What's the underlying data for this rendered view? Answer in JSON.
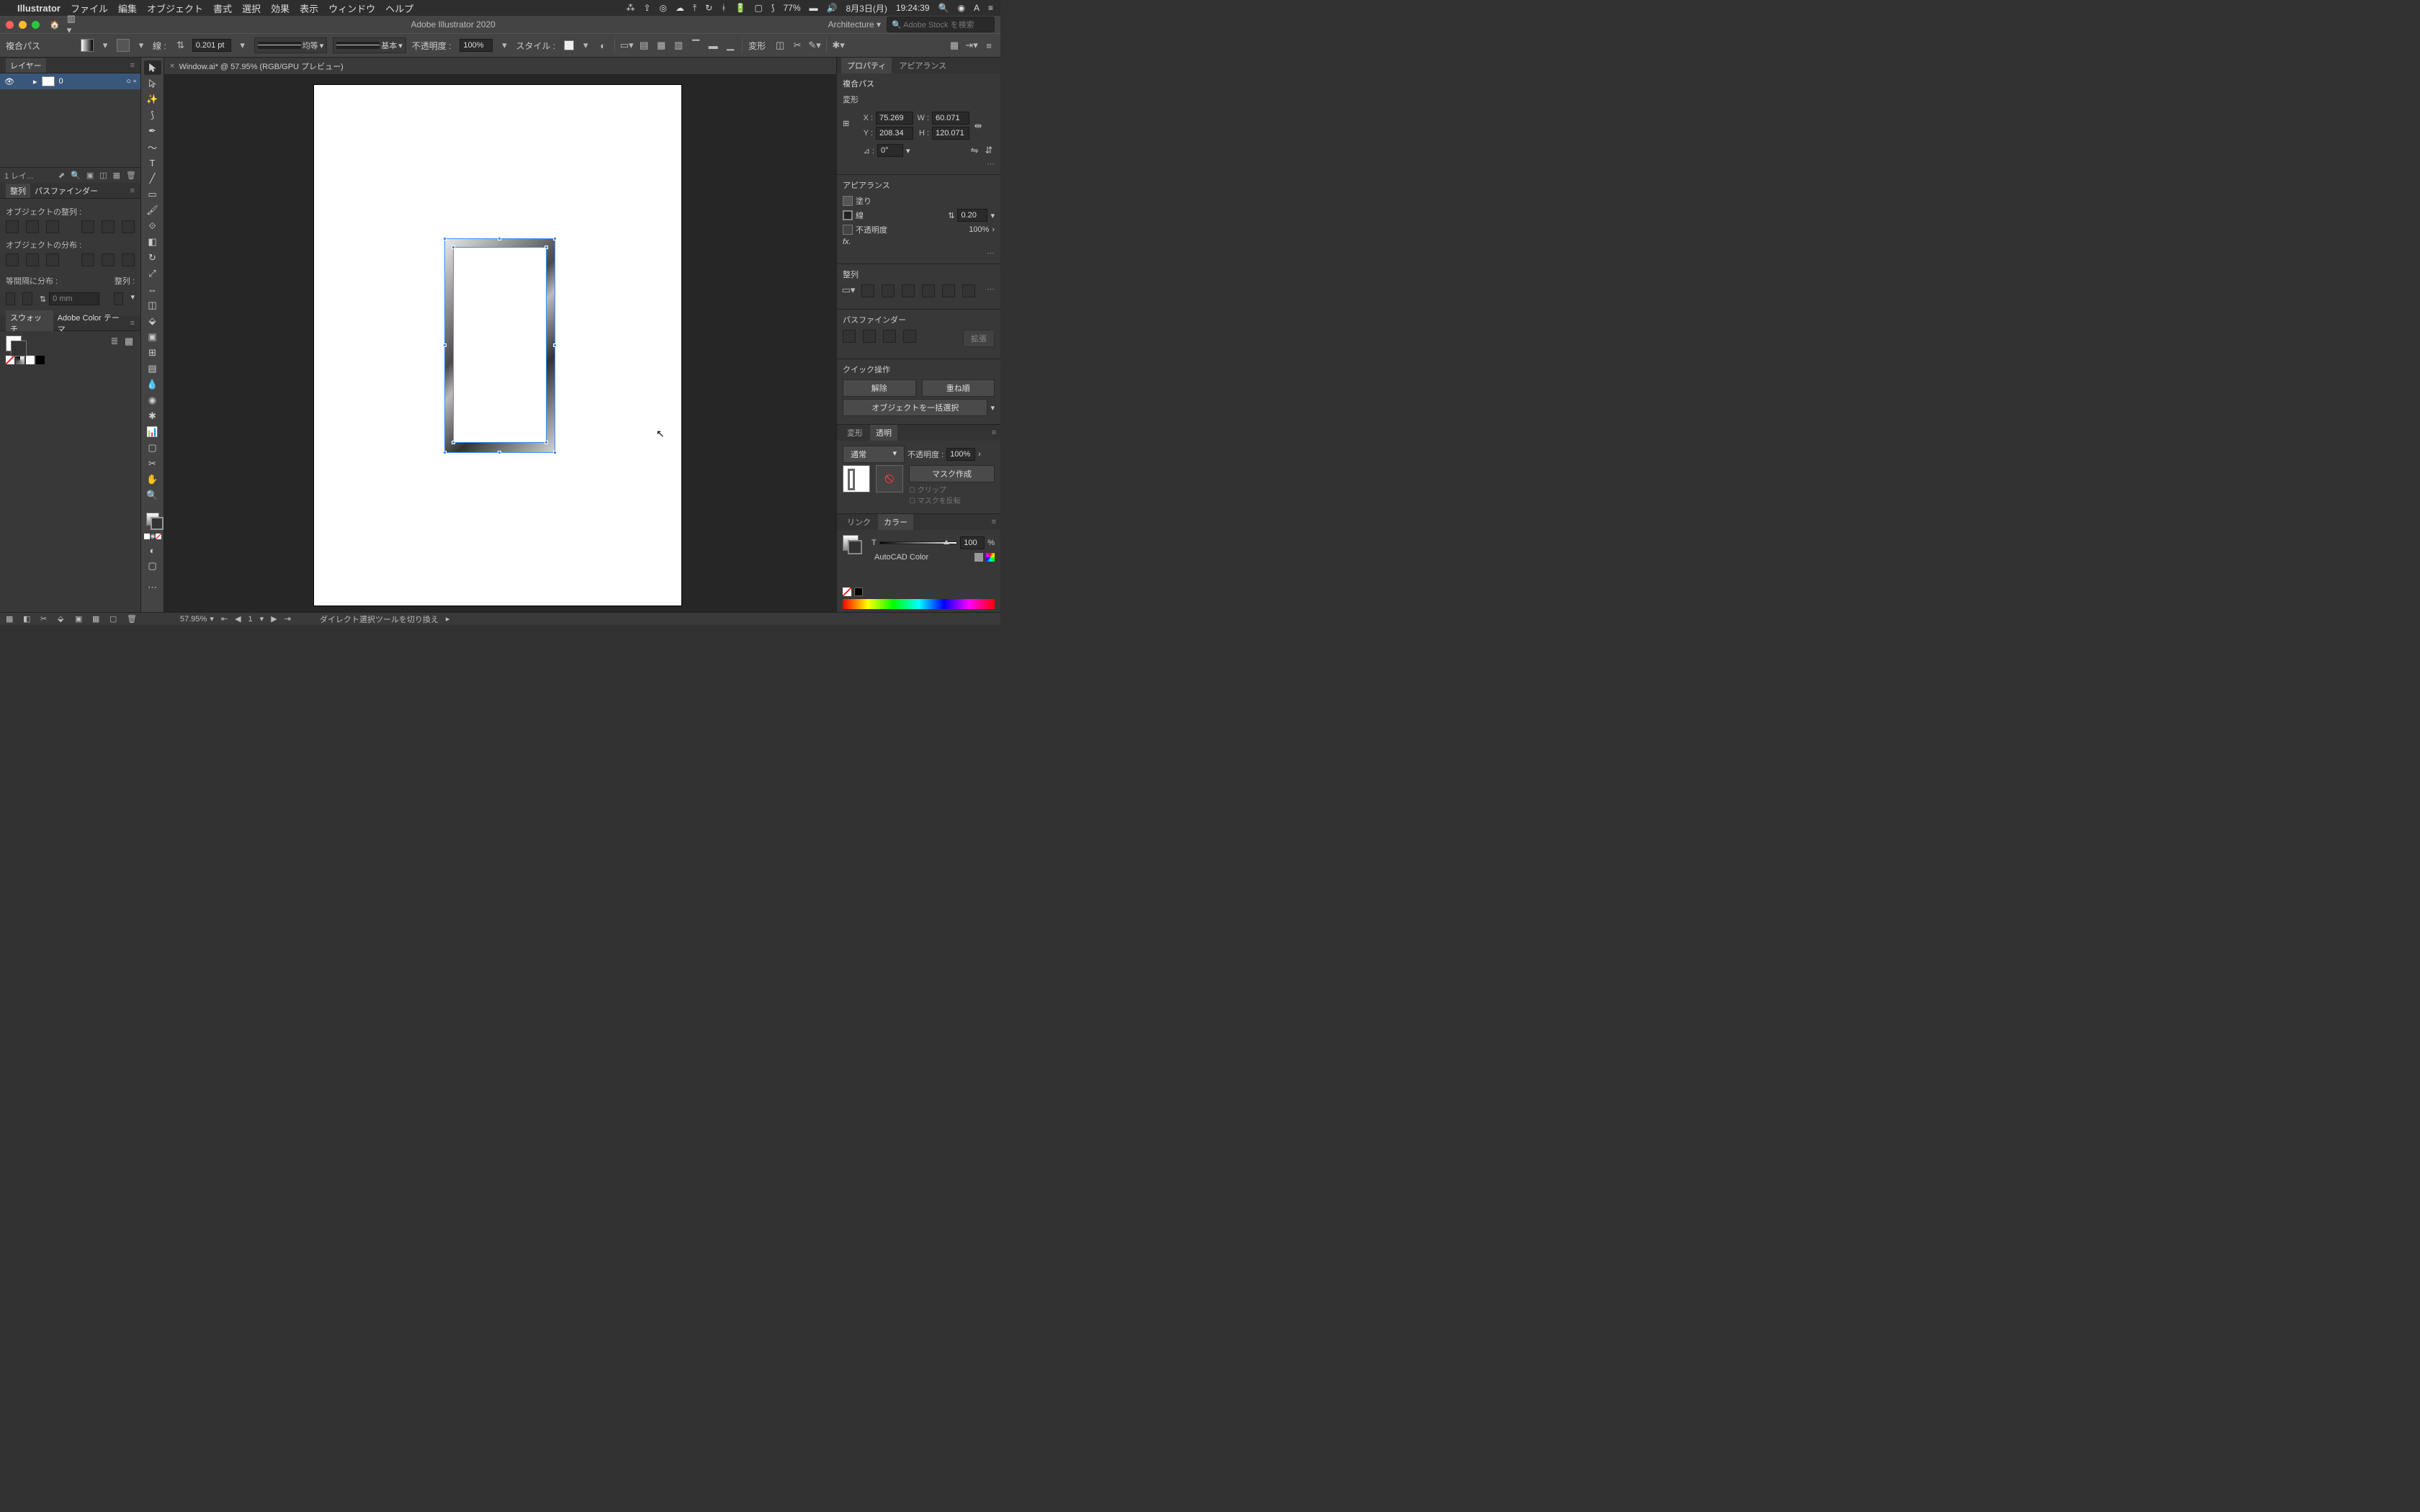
{
  "menubar": {
    "app": "Illustrator",
    "items": [
      "ファイル",
      "編集",
      "オブジェクト",
      "書式",
      "選択",
      "効果",
      "表示",
      "ウィンドウ",
      "ヘルプ"
    ],
    "battery": "77%",
    "date": "8月3日(月)",
    "time": "19:24:39"
  },
  "titlebar": {
    "title": "Adobe Illustrator 2020",
    "workspace": "Architecture",
    "search_placeholder": "Adobe Stock を検索"
  },
  "controlbar": {
    "selection_label": "複合パス",
    "stroke_label": "線 :",
    "stroke_pt": "0.201 pt",
    "stroke_style": "均等",
    "stroke_profile": "基本",
    "opacity_label": "不透明度 :",
    "opacity_value": "100%",
    "style_label": "スタイル :",
    "transform_label": "変形"
  },
  "tab": {
    "name": "Window.ai* @ 57.95% (RGB/GPU プレビュー)"
  },
  "panels": {
    "layers": {
      "tab": "レイヤー",
      "layer_name": "0",
      "status": "1 レイ..."
    },
    "align": {
      "tabs": [
        "整列",
        "パスファインダー"
      ],
      "obj_align": "オブジェクトの整列 :",
      "obj_distribute": "オブジェクトの分布 :",
      "spacing": "等間隔に分布 :",
      "alignto": "整列 :",
      "gap": "0 mm"
    },
    "swatches": {
      "tabs": [
        "スウォッチ",
        "Adobe Color テーマ"
      ]
    }
  },
  "properties": {
    "tabs": [
      "プロパティ",
      "アピアランス"
    ],
    "selection": "複合パス",
    "transform": {
      "label": "変形",
      "x_label": "X :",
      "x": "75.269",
      "w_label": "W :",
      "w": "60.071",
      "y_label": "Y :",
      "y": "208.34",
      "h_label": "H :",
      "h": "120.071",
      "angle_label": "⊿ :",
      "angle": "0°"
    },
    "appearance": {
      "label": "アピアランス",
      "fill": "塗り",
      "stroke": "線",
      "stroke_w": "0.20",
      "opacity": "不透明度",
      "opacity_v": "100%",
      "fx": "fx."
    },
    "align": {
      "label": "整列"
    },
    "pathfinder": {
      "label": "パスファインダー",
      "expand": "拡張"
    },
    "quick": {
      "label": "クイック操作",
      "release": "解除",
      "arrange": "重ね順",
      "batch_select": "オブジェクトを一括選択"
    }
  },
  "transparency": {
    "tabs": [
      "変形",
      "透明"
    ],
    "blend": "通常",
    "opacity_label": "不透明度 :",
    "opacity": "100%",
    "make_mask": "マスク作成",
    "clip": "クリップ",
    "invert": "マスクを反転"
  },
  "color": {
    "tabs": [
      "リンク",
      "カラー"
    ],
    "tint_label": "T",
    "value": "100",
    "pct": "%",
    "name": "AutoCAD Color"
  },
  "statusbar": {
    "zoom": "57.95%",
    "artboard": "1",
    "tool": "ダイレクト選択ツールを切り換え"
  }
}
